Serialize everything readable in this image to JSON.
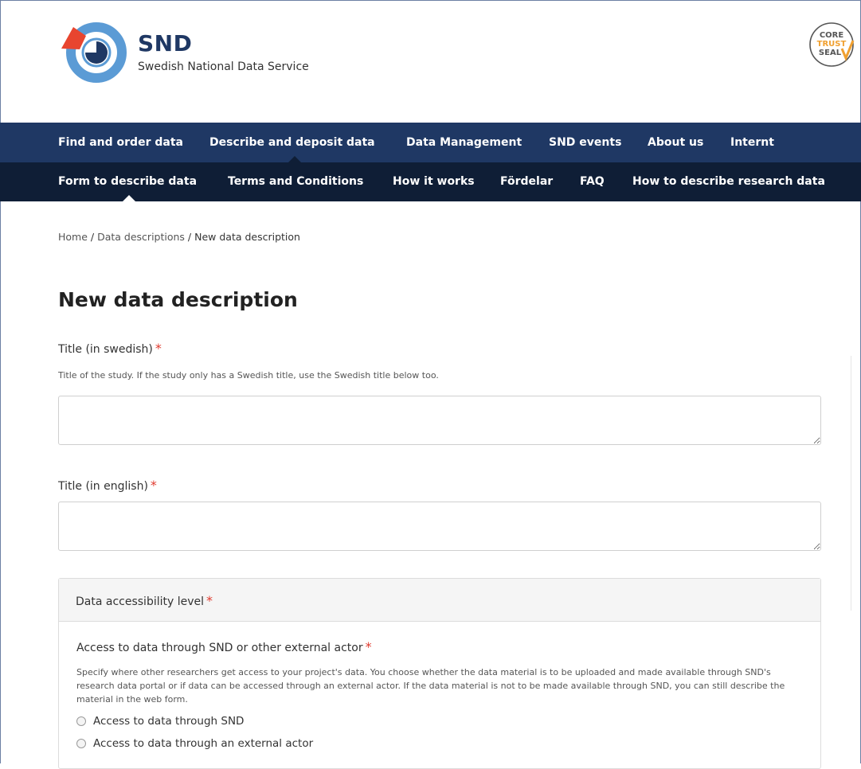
{
  "brand": {
    "name": "SND",
    "subtitle": "Swedish National Data Service",
    "seal": [
      "CORE",
      "TRUST",
      "SEAL"
    ]
  },
  "nav": {
    "primary": [
      {
        "label": "Find and order data",
        "active": false
      },
      {
        "label": "Describe and deposit data",
        "active": true
      },
      {
        "label": "Data Management",
        "active": false
      },
      {
        "label": "SND events",
        "active": false
      },
      {
        "label": "About us",
        "active": false
      },
      {
        "label": "Internt",
        "active": false
      }
    ],
    "secondary": [
      {
        "label": "Form to describe data",
        "active": true
      },
      {
        "label": "Terms and Conditions",
        "active": false
      },
      {
        "label": "How it works",
        "active": false
      },
      {
        "label": "Fördelar",
        "active": false
      },
      {
        "label": "FAQ",
        "active": false
      },
      {
        "label": "How to describe research data",
        "active": false
      }
    ]
  },
  "breadcrumb": {
    "home": "Home",
    "sep": " / ",
    "descriptions": "Data descriptions",
    "current": "New data description"
  },
  "page": {
    "title": "New data description"
  },
  "form": {
    "required_marker": "*",
    "title_sv": {
      "label": "Title (in swedish)",
      "help": "Title of the study. If the study only has a Swedish title, use the Swedish title below too.",
      "value": ""
    },
    "title_en": {
      "label": "Title (in english)",
      "value": ""
    },
    "accessibility": {
      "panel_title": "Data accessibility level",
      "question": "Access to data through SND or other external actor",
      "help": "Specify where other researchers get access to your project's data. You choose whether the data material is to be uploaded and made available through SND's research data portal or if data can be accessed through an external actor. If the data material is not to be made available through SND, you can still describe the material in the web form.",
      "options": [
        {
          "label": "Access to data through SND",
          "selected": false
        },
        {
          "label": "Access to data through an external actor",
          "selected": false
        }
      ]
    }
  },
  "colors": {
    "nav_primary": "#1f3864",
    "nav_secondary": "#0f1e36",
    "required": "#e03a2e",
    "logo_blue": "#5b9bd5",
    "logo_red": "#e8452f",
    "logo_navy": "#1f3864",
    "seal_orange": "#f0a030"
  }
}
